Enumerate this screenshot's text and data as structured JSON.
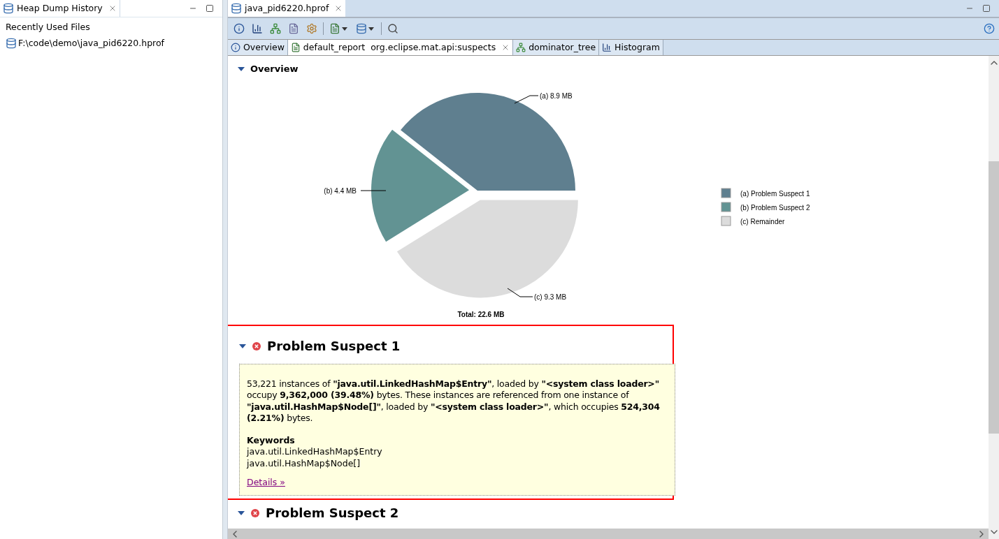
{
  "left_panel": {
    "tab": {
      "title": "Heap Dump History",
      "selected": true
    },
    "section_title": "Recently Used Files",
    "files": [
      {
        "path": "F:\\code\\demo\\java_pid6220.hprof"
      }
    ]
  },
  "editor": {
    "tab": {
      "title": "java_pid6220.hprof",
      "selected": true
    },
    "toolbar": [
      {
        "kind": "info",
        "dropdown": false
      },
      {
        "kind": "histogram",
        "dropdown": false
      },
      {
        "kind": "tree",
        "dropdown": false
      },
      {
        "kind": "query",
        "dropdown": false
      },
      {
        "kind": "gears",
        "dropdown": false
      },
      {
        "kind": "separator"
      },
      {
        "kind": "report",
        "dropdown": true
      },
      {
        "kind": "database",
        "dropdown": true
      },
      {
        "kind": "separator"
      },
      {
        "kind": "search",
        "dropdown": false
      }
    ],
    "inner_tabs": [
      {
        "label": "Overview",
        "kind": "info",
        "selected": false,
        "closable": false
      },
      {
        "label": "default_report  org.eclipse.mat.api:suspects",
        "kind": "report",
        "selected": true,
        "closable": true
      },
      {
        "label": "dominator_tree",
        "kind": "tree",
        "selected": false,
        "closable": false
      },
      {
        "label": "Histogram",
        "kind": "histogram",
        "selected": false,
        "closable": false
      }
    ]
  },
  "report": {
    "overview": {
      "title": "Overview",
      "expanded": true,
      "chart_data": {
        "type": "pie",
        "categories": [
          "(a)  Problem Suspect 1",
          "(b)  Problem Suspect 2",
          "(c)  Remainder"
        ],
        "values": [
          8.9,
          4.4,
          9.3
        ],
        "value_labels": [
          "(a)  8.9 MB",
          "(b)  4.4 MB",
          "(c)  9.3 MB"
        ],
        "xlabel": "Total: 22.6 MB",
        "legend": "right"
      },
      "slices": [
        {
          "color": "#5f7f8f"
        },
        {
          "color": "#629393"
        },
        {
          "color": "#dcdcdc"
        }
      ]
    },
    "suspects": [
      {
        "title": "Problem Suspect 1",
        "expanded": true,
        "highlighted": true,
        "description": "53,221 instances of **\"java.util.LinkedHashMap$Entry\"**, loaded by **\"<system class loader>\"** occupy **9,362,000 (39.48%)** bytes. These instances are referenced from one instance of **\"java.util.HashMap$Node[]\"**, loaded by **\"<system class loader>\"**, which occupies **524,304 (2.21%)** bytes.",
        "keywords_title": "Keywords",
        "keywords": [
          "java.util.LinkedHashMap$Entry",
          "java.util.HashMap$Node[]"
        ],
        "link": "Details »"
      },
      {
        "title": "Problem Suspect 2",
        "expanded": true,
        "highlighted": false
      }
    ]
  }
}
